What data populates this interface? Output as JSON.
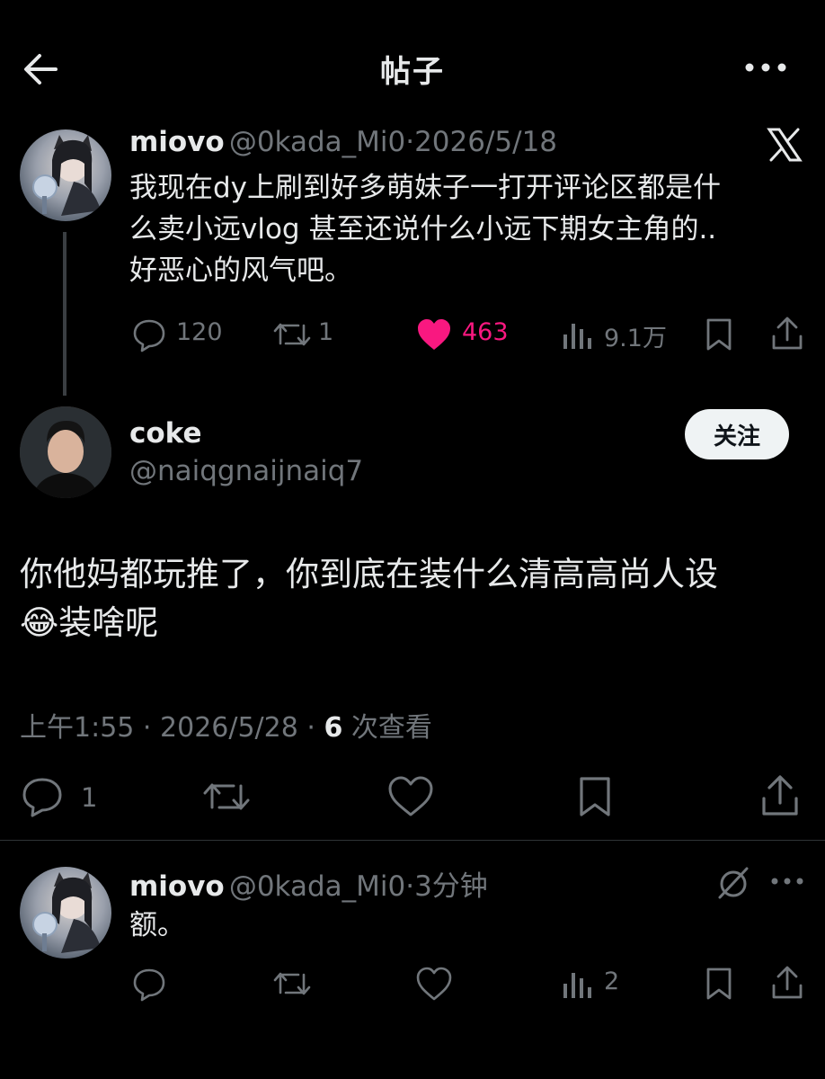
{
  "header": {
    "title": "帖子"
  },
  "parent_post": {
    "display_name": "miovo",
    "handle": "@0kada_Mi0",
    "separator": "·",
    "date": "2026/5/18",
    "text_lines": [
      "我现在dy上刷到好多萌妹子一打开评论区都是什",
      "么卖小远vlog 甚至还说什么小远下期女主角的..",
      "好恶心的风气吧。"
    ],
    "replies": "120",
    "reposts": "1",
    "likes": "463",
    "views": "9.1万",
    "like_color": "#f91880"
  },
  "main_post": {
    "display_name": "coke",
    "handle": "@naiqgnaijnaiq7",
    "follow_label": "关注",
    "text_line1": "你他妈都玩推了，你到底在装什么清高高尚人设",
    "emoji": "😂",
    "text_line2": "装啥呢",
    "time": "上午1:55",
    "date": "2026/5/28",
    "separator": "·",
    "views_count": "6",
    "views_label": "次查看",
    "replies": "1"
  },
  "reply_post": {
    "display_name": "miovo",
    "handle": "@0kada_Mi0",
    "separator": "·",
    "time": "3分钟",
    "text": "额。",
    "views": "2"
  },
  "colors": {
    "background": "#000000",
    "text": "#e7e9ea",
    "muted": "#71767b",
    "like": "#f91880"
  }
}
